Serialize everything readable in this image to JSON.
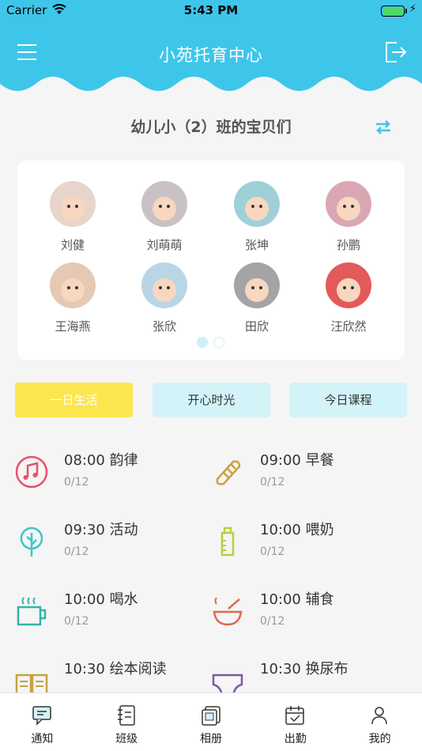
{
  "status_bar": {
    "carrier": "Carrier",
    "time": "5:43 PM"
  },
  "header": {
    "title": "小苑托育中心",
    "menu_icon": "menu-icon",
    "logout_icon": "logout-icon",
    "color": "#3ec6ea"
  },
  "class_title": "幼儿小（2）班的宝贝们",
  "babies": [
    {
      "name": "刘健"
    },
    {
      "name": "刘萌萌"
    },
    {
      "name": "张坤"
    },
    {
      "name": "孙鹏"
    },
    {
      "name": "王海燕"
    },
    {
      "name": "张欣"
    },
    {
      "name": "田欣"
    },
    {
      "name": "汪欣然"
    }
  ],
  "pager": {
    "pages": 2,
    "current": 1
  },
  "tabs": [
    {
      "label": "一日生活",
      "active": true
    },
    {
      "label": "开心时光",
      "active": false
    },
    {
      "label": "今日课程",
      "active": false
    }
  ],
  "schedule": [
    {
      "label": "08:00 韵律",
      "count": "0/12",
      "icon": "music-note-icon",
      "color": "#e8506d"
    },
    {
      "label": "09:00 早餐",
      "count": "0/12",
      "icon": "bread-icon",
      "color": "#c9a13c"
    },
    {
      "label": "09:30 活动",
      "count": "0/12",
      "icon": "tree-icon",
      "color": "#3ec6c6"
    },
    {
      "label": "10:00 喂奶",
      "count": "0/12",
      "icon": "baby-bottle-icon",
      "color": "#b6cf3f"
    },
    {
      "label": "10:00 喝水",
      "count": "0/12",
      "icon": "cup-icon",
      "color": "#35b3a6"
    },
    {
      "label": "10:00 辅食",
      "count": "0/12",
      "icon": "bowl-icon",
      "color": "#e2674f"
    },
    {
      "label": "10:30 绘本阅读",
      "count": "",
      "icon": "book-icon",
      "color": "#c9a13c"
    },
    {
      "label": "10:30 换尿布",
      "count": "",
      "icon": "diaper-icon",
      "color": "#7a5aa0"
    }
  ],
  "tabbar": [
    {
      "label": "通知",
      "icon": "notice-icon",
      "active": true
    },
    {
      "label": "班级",
      "icon": "class-icon",
      "active": false
    },
    {
      "label": "相册",
      "icon": "album-icon",
      "active": false
    },
    {
      "label": "出勤",
      "icon": "attendance-icon",
      "active": false
    },
    {
      "label": "我的",
      "icon": "profile-icon",
      "active": false
    }
  ]
}
